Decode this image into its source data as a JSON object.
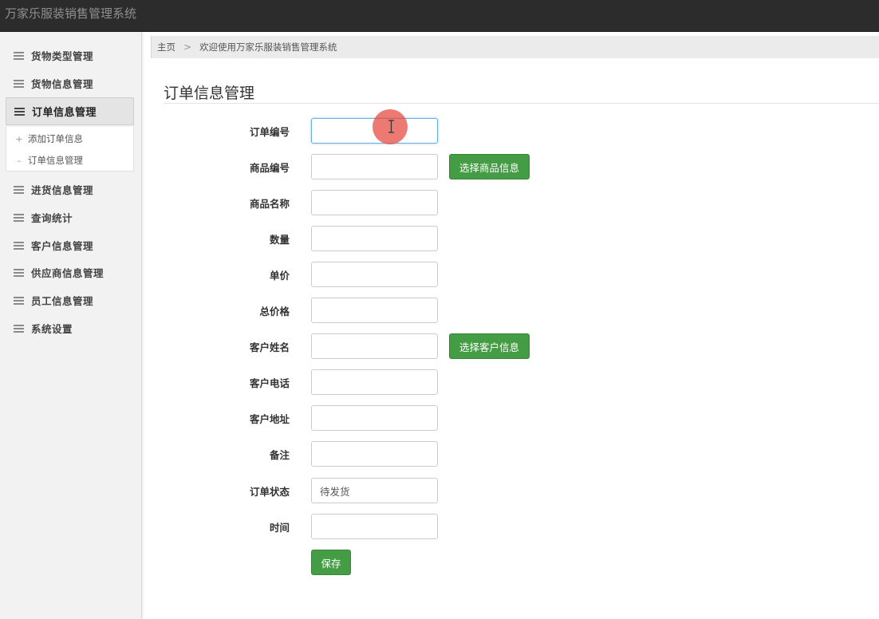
{
  "app": {
    "title": "万家乐服装销售管理系统"
  },
  "sidebar": {
    "items": [
      {
        "label": "货物类型管理",
        "icon": "menu-lines-icon"
      },
      {
        "label": "货物信息管理",
        "icon": "menu-lines-icon"
      },
      {
        "label": "订单信息管理",
        "icon": "menu-lines-icon",
        "active": true,
        "children": [
          {
            "label": "添加订单信息",
            "icon": "plus-icon"
          },
          {
            "label": "订单信息管理",
            "icon": "dash-icon"
          }
        ]
      },
      {
        "label": "进货信息管理",
        "icon": "menu-lines-icon"
      },
      {
        "label": "查询统计",
        "icon": "menu-lines-icon"
      },
      {
        "label": "客户信息管理",
        "icon": "menu-lines-icon"
      },
      {
        "label": "供应商信息管理",
        "icon": "menu-lines-icon"
      },
      {
        "label": "员工信息管理",
        "icon": "menu-lines-icon"
      },
      {
        "label": "系统设置",
        "icon": "menu-lines-icon"
      }
    ]
  },
  "breadcrumb": {
    "home": "主页",
    "separator": ">",
    "current": "欢迎使用万家乐服装销售管理系统"
  },
  "main": {
    "title": "订单信息管理"
  },
  "form": {
    "fields": [
      {
        "label": "订单编号",
        "value": "",
        "focused": true
      },
      {
        "label": "商品编号",
        "value": "",
        "button": "选择商品信息"
      },
      {
        "label": "商品名称",
        "value": ""
      },
      {
        "label": "数量",
        "value": ""
      },
      {
        "label": "单价",
        "value": ""
      },
      {
        "label": "总价格",
        "value": ""
      },
      {
        "label": "客户姓名",
        "value": "",
        "button": "选择客户信息"
      },
      {
        "label": "客户电话",
        "value": ""
      },
      {
        "label": "客户地址",
        "value": ""
      },
      {
        "label": "备注",
        "value": ""
      },
      {
        "label": "订单状态",
        "value": "待发货"
      },
      {
        "label": "时间",
        "value": ""
      }
    ],
    "save_label": "保存"
  },
  "colors": {
    "topbar": "#2c2c2c",
    "button_green": "#449d44",
    "focus_blue": "#66afe9",
    "cursor_highlight": "#e6463c"
  }
}
